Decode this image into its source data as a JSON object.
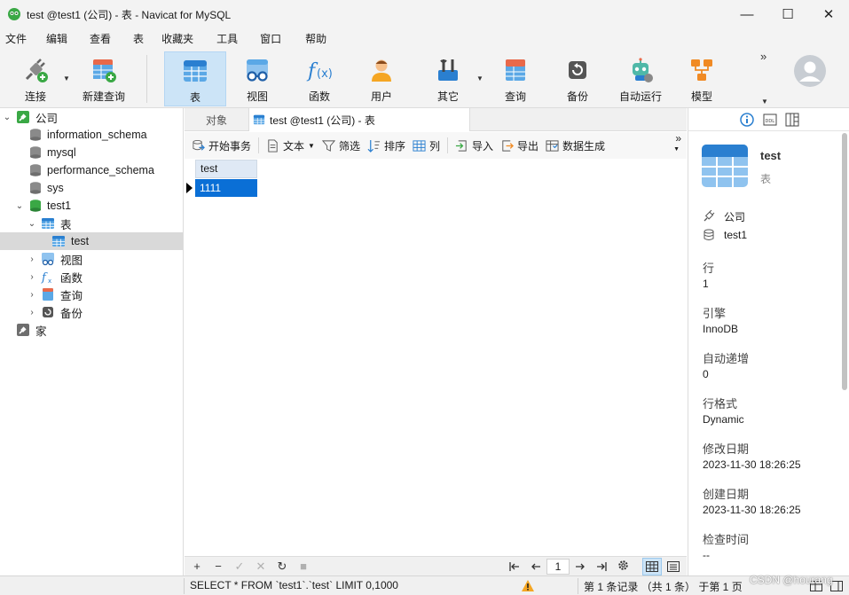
{
  "window": {
    "title": "test @test1 (公司) - 表 - Navicat for MySQL",
    "minimize": "—",
    "maximize": "☐",
    "close": "✕"
  },
  "menu": [
    "文件",
    "编辑",
    "查看",
    "表",
    "收藏夹",
    "工具",
    "窗口",
    "帮助"
  ],
  "toolbar": {
    "connect": "连接",
    "new_query": "新建查询",
    "table": "表",
    "view": "视图",
    "function": "函数",
    "user": "用户",
    "other": "其它",
    "query": "查询",
    "backup": "备份",
    "automation": "自动运行",
    "model": "模型",
    "more": "»"
  },
  "tree": {
    "connection": "公司",
    "databases": [
      "information_schema",
      "mysql",
      "performance_schema",
      "sys"
    ],
    "active_db": "test1",
    "tables_group": "表",
    "table": "test",
    "groups": [
      "视图",
      "函数",
      "查询",
      "备份"
    ],
    "other_connection": "家"
  },
  "tabs": {
    "objects": "对象",
    "current": "test @test1 (公司) - 表"
  },
  "subtoolbar": {
    "begin_transaction": "开始事务",
    "text": "文本",
    "filter": "筛选",
    "sort": "排序",
    "columns": "列",
    "import": "导入",
    "export": "导出",
    "generate": "数据生成",
    "more": "»"
  },
  "grid": {
    "columns": [
      "test"
    ],
    "rows": [
      [
        "1111"
      ]
    ]
  },
  "navbar": {
    "add": "+",
    "remove": "−",
    "apply": "✓",
    "discard": "✕",
    "refresh": "↻",
    "stop": "■",
    "page": "1"
  },
  "info": {
    "name": "test",
    "type": "表",
    "connection": "公司",
    "database": "test1",
    "properties": [
      {
        "label": "行",
        "value": "1"
      },
      {
        "label": "引擎",
        "value": "InnoDB"
      },
      {
        "label": "自动递增",
        "value": "0"
      },
      {
        "label": "行格式",
        "value": "Dynamic"
      },
      {
        "label": "修改日期",
        "value": "2023-11-30 18:26:25"
      },
      {
        "label": "创建日期",
        "value": "2023-11-30 18:26:25"
      },
      {
        "label": "检查时间",
        "value": "--"
      }
    ]
  },
  "status": {
    "sql": "SELECT * FROM `test1`.`test` LIMIT 0,1000",
    "records": "第 1 条记录 （共 1 条） 于第 1 页",
    "watermark": "CSDN @hourang"
  },
  "colors": {
    "accent": "#0a6fd6",
    "active_tool": "#cce4f7",
    "warning": "#f5a623"
  }
}
